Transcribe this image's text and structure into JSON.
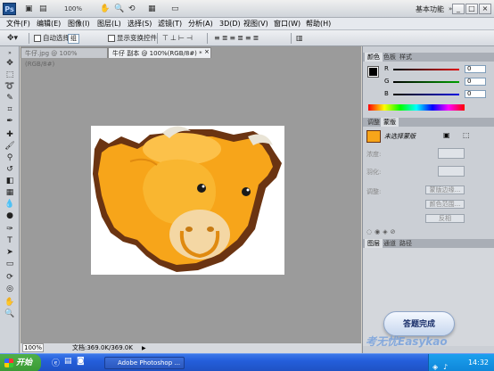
{
  "titlebar": {
    "logo": "Ps",
    "zoom": "100%",
    "workspace": "基本功能",
    "min": "_",
    "restore": "□",
    "close": "×",
    "brand_color": "#1d4f8e"
  },
  "menu": [
    "文件(F)",
    "编辑(E)",
    "图像(I)",
    "图层(L)",
    "选择(S)",
    "滤镜(T)",
    "分析(A)",
    "3D(D)",
    "视图(V)",
    "窗口(W)",
    "帮助(H)"
  ],
  "options": {
    "auto_select": "自动选择:",
    "auto_select_value": "组",
    "show_transform": "显示变换控件"
  },
  "tabs": [
    {
      "label": "牛仔.jpg @ 100%(RGB/8#)",
      "active": false
    },
    {
      "label": "牛仔 副本 @ 100%(RGB/8#) *",
      "active": true
    }
  ],
  "status": {
    "zoom": "100%",
    "doc": "文档:369.0K/369.0K"
  },
  "color_panel": {
    "tabs": [
      "颜色",
      "色板",
      "样式"
    ],
    "channels": [
      {
        "label": "R",
        "value": "0",
        "color": "#e00000"
      },
      {
        "label": "G",
        "value": "0",
        "color": "#00a000"
      },
      {
        "label": "B",
        "value": "0",
        "color": "#0000e0"
      }
    ]
  },
  "adjust_panel": {
    "tabs": [
      "调整",
      "蒙版"
    ],
    "title": "未选择蒙版",
    "density_label": "浓度:",
    "feather_label": "羽化:",
    "refine_label": "调整:",
    "mask_edge": "蒙版边缘...",
    "color_range": "颜色范围...",
    "invert": "反相"
  },
  "layers_panel": {
    "tabs": [
      "图层",
      "通道",
      "路径"
    ]
  },
  "overlay": {
    "completion": "答题完成",
    "watermark": "考无忧Easykao"
  },
  "taskbar": {
    "start": "开始",
    "task": "Adobe Photoshop ...",
    "clock": "14:32"
  }
}
